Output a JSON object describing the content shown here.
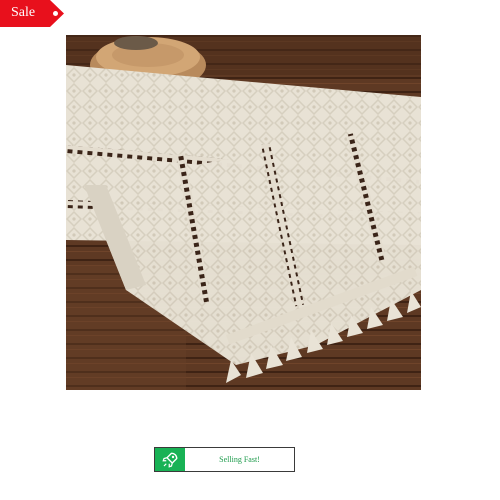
{
  "sale_tag": {
    "label": "Sale",
    "color": "#e8101c"
  },
  "product_image": {
    "subject": "cream woven macrame table runner with tassel fringe on dark wooden floor"
  },
  "badge": {
    "text": "Selling Fast!",
    "icon": "rocket-icon",
    "accent": "#18b255"
  }
}
